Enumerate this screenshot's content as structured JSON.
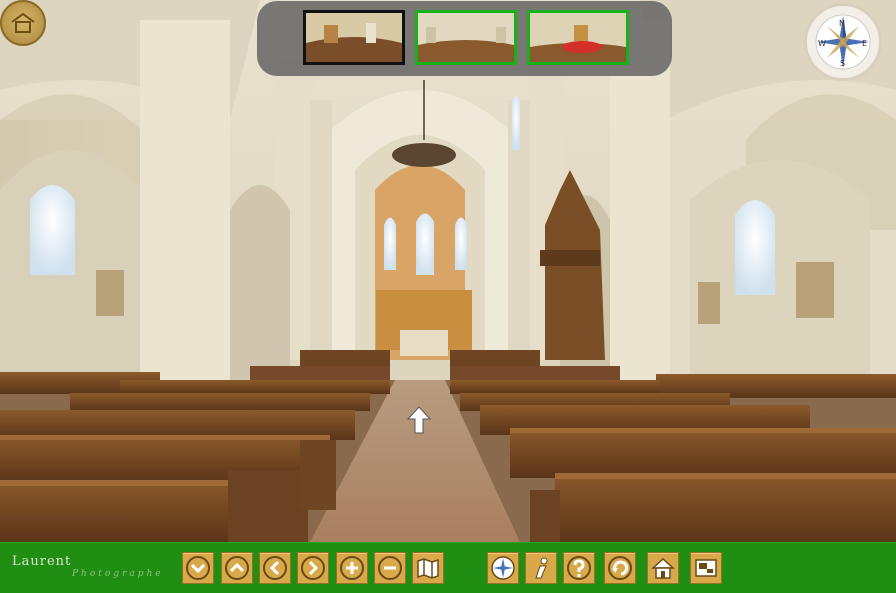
{
  "app": {
    "title": "Virtual tour – church interior panorama"
  },
  "branding": {
    "name": "Laurent",
    "subtitle": "Photographe"
  },
  "thumbnails": [
    {
      "name": "scene-1",
      "active": false,
      "border": "#101010"
    },
    {
      "name": "scene-2",
      "active": true,
      "border": "#17b21a"
    },
    {
      "name": "scene-3",
      "active": true,
      "border": "#17b21a"
    }
  ],
  "compass": {
    "north": "N",
    "south": "S",
    "east": "E",
    "west": "W"
  },
  "toolbar": {
    "background": "#1f8e13",
    "button_color": "#d7a94b",
    "buttons": [
      {
        "name": "look-down-button",
        "icon": "chevron-down-icon"
      },
      {
        "name": "look-up-button",
        "icon": "chevron-up-icon"
      },
      {
        "name": "look-left-button",
        "icon": "chevron-left-icon"
      },
      {
        "name": "look-right-button",
        "icon": "chevron-right-icon"
      },
      {
        "name": "zoom-in-button",
        "icon": "plus-icon"
      },
      {
        "name": "zoom-out-button",
        "icon": "minus-icon"
      },
      {
        "name": "map-button",
        "icon": "map-icon"
      },
      {
        "name": "compass-button",
        "icon": "compass-icon"
      },
      {
        "name": "info-button",
        "icon": "info-icon"
      },
      {
        "name": "help-button",
        "icon": "question-icon"
      },
      {
        "name": "autorotate-button",
        "icon": "rotate-icon"
      },
      {
        "name": "home-button",
        "icon": "house-icon"
      },
      {
        "name": "fullscreen-button",
        "icon": "fullscreen-icon"
      }
    ]
  }
}
